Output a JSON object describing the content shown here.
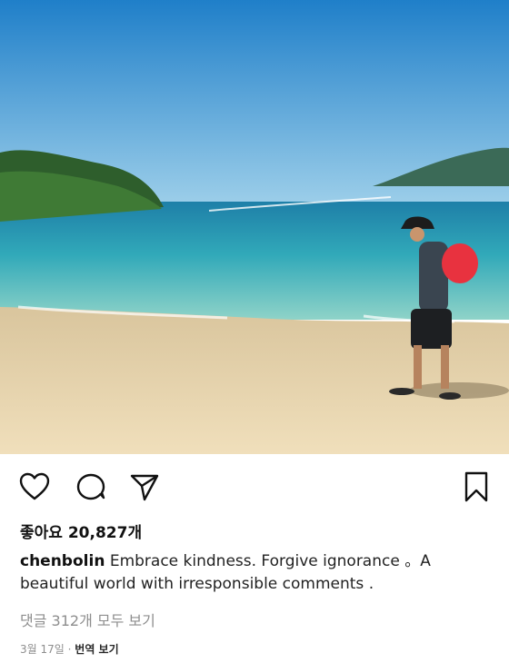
{
  "post": {
    "username": "chenbolin",
    "caption": "Embrace kindness. Forgive ignorance 。A beautiful world with irresponsible comments .",
    "likes_label": "좋아요",
    "likes_count": "20,827개",
    "comments_link": "댓글 312개 모두 보기",
    "date": "3월 17일",
    "separator": "·",
    "translate_label": "번역 보기"
  },
  "icons": {
    "like": "heart-icon",
    "comment": "comment-bubble-icon",
    "share": "paper-plane-icon",
    "save": "bookmark-icon"
  },
  "colors": {
    "sky": "#2f8fd0",
    "sea": "#2fb2c0",
    "sand": "#e6d3ac",
    "bag": "#e8323f"
  }
}
